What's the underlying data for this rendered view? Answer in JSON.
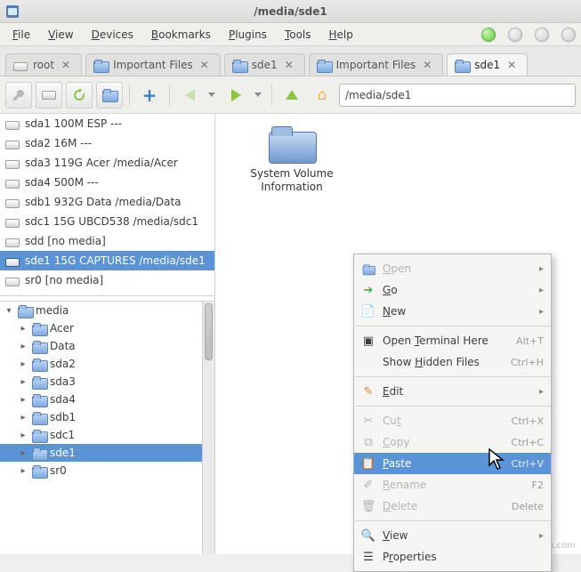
{
  "window": {
    "title": "/media/sde1"
  },
  "menubar": {
    "items": [
      {
        "u": "F",
        "rest": "ile"
      },
      {
        "u": "V",
        "rest": "iew"
      },
      {
        "u": "D",
        "rest": "evices"
      },
      {
        "u": "B",
        "rest": "ookmarks"
      },
      {
        "u": "P",
        "rest": "lugins"
      },
      {
        "u": "T",
        "rest": "ools"
      },
      {
        "u": "H",
        "rest": "elp"
      }
    ]
  },
  "tabs": {
    "items": [
      {
        "label": "root",
        "icon": "hdd"
      },
      {
        "label": "Important Files",
        "icon": "folder"
      },
      {
        "label": "sde1",
        "icon": "folder"
      },
      {
        "label": "Important Files",
        "icon": "folder"
      },
      {
        "label": "sde1",
        "icon": "folder",
        "active": true
      }
    ]
  },
  "toolbar": {
    "path": "/media/sde1"
  },
  "volumes": {
    "items": [
      {
        "label": "sda1 100M ESP ---"
      },
      {
        "label": "sda2 16M ---"
      },
      {
        "label": "sda3 119G Acer /media/Acer"
      },
      {
        "label": "sda4 500M ---"
      },
      {
        "label": "sdb1 932G Data /media/Data"
      },
      {
        "label": "sdc1 15G UBCD538 /media/sdc1"
      },
      {
        "label": "sdd [no media]"
      },
      {
        "label": "sde1 15G CAPTURES /media/sde1",
        "selected": true
      },
      {
        "label": "sr0 [no media]"
      }
    ]
  },
  "tree": {
    "root": {
      "label": "media"
    },
    "children": [
      {
        "label": "Acer"
      },
      {
        "label": "Data"
      },
      {
        "label": "sda2"
      },
      {
        "label": "sda3"
      },
      {
        "label": "sda4"
      },
      {
        "label": "sdb1"
      },
      {
        "label": "sdc1"
      },
      {
        "label": "sde1",
        "selected": true
      },
      {
        "label": "sr0"
      }
    ]
  },
  "fileview": {
    "items": [
      {
        "name": "System Volume Information"
      }
    ]
  },
  "context_menu": {
    "groups": [
      [
        {
          "icon": "folder",
          "u": "O",
          "rest": "pen",
          "sub": true,
          "disabled": true
        },
        {
          "icon": "go",
          "u": "G",
          "rest": "o",
          "sub": true
        },
        {
          "icon": "new",
          "u": "N",
          "rest": "ew",
          "sub": true
        }
      ],
      [
        {
          "icon": "term",
          "pre": "Open ",
          "u": "T",
          "rest": "erminal Here",
          "accel": "Alt+T"
        },
        {
          "icon": "",
          "pre": "Show ",
          "u": "H",
          "rest": "idden Files",
          "accel": "Ctrl+H"
        }
      ],
      [
        {
          "icon": "edit",
          "u": "E",
          "rest": "dit",
          "sub": true
        }
      ],
      [
        {
          "icon": "cut",
          "pre": "Cu",
          "u": "t",
          "rest": "",
          "accel": "Ctrl+X",
          "disabled": true
        },
        {
          "icon": "copy",
          "u": "C",
          "rest": "opy",
          "accel": "Ctrl+C",
          "disabled": true
        },
        {
          "icon": "paste",
          "u": "P",
          "rest": "aste",
          "accel": "Ctrl+V",
          "selected": true
        },
        {
          "icon": "rename",
          "u": "R",
          "rest": "ename",
          "accel": "F2",
          "disabled": true
        },
        {
          "icon": "delete",
          "u": "D",
          "rest": "elete",
          "accel": "Delete",
          "disabled": true
        }
      ],
      [
        {
          "icon": "view",
          "u": "V",
          "rest": "iew",
          "sub": true
        },
        {
          "icon": "props",
          "pre": "P",
          "u": "r",
          "rest": "operties"
        }
      ]
    ]
  },
  "watermark": "wsxdn.com"
}
